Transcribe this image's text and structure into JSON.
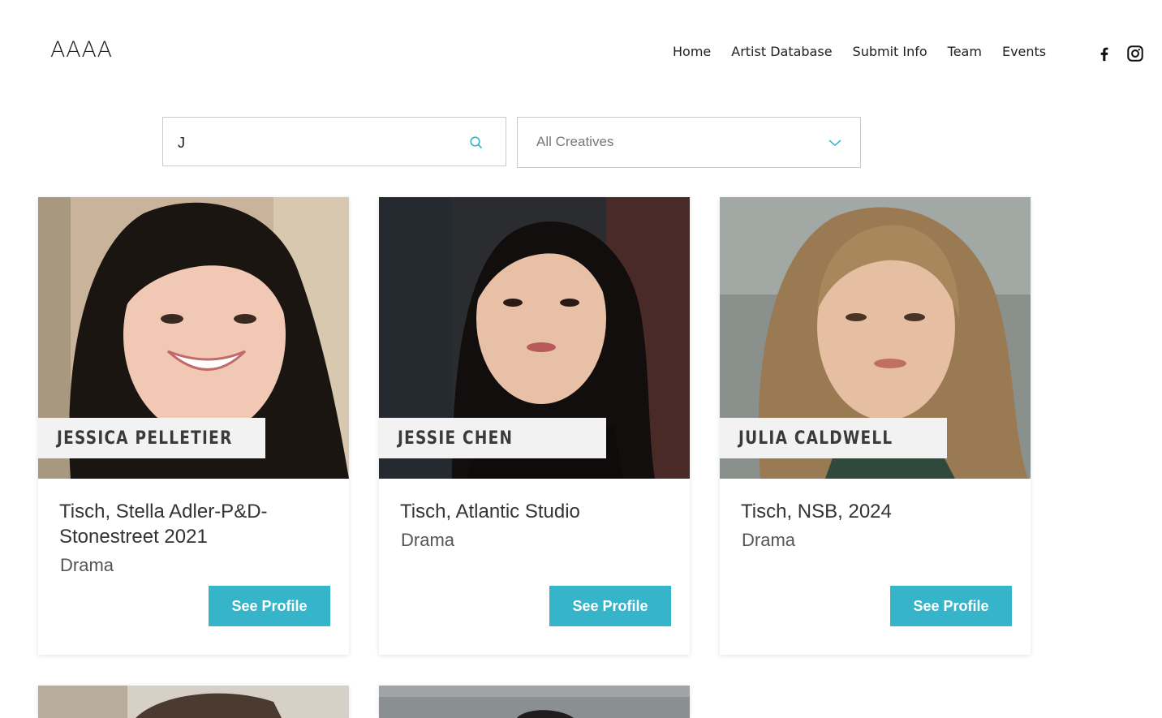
{
  "site": {
    "logo": "AAAA"
  },
  "nav": {
    "items": [
      "Home",
      "Artist Database",
      "Submit Info",
      "Team",
      "Events"
    ]
  },
  "social": [
    "facebook-icon",
    "instagram-icon"
  ],
  "search": {
    "value": "J",
    "icon": "search-icon"
  },
  "filter": {
    "selected": "All Creatives",
    "icon": "chevron-down-icon"
  },
  "colors": {
    "accent": "#36b4c9",
    "name_tag_bg": "#f2f2f2"
  },
  "artists": [
    {
      "name": "JESSICA PELLETIER",
      "school": "Tisch, Stella Adler-P&D-Stonestreet 2021",
      "department": "Drama",
      "button": "See Profile"
    },
    {
      "name": "JESSIE CHEN",
      "school": "Tisch, Atlantic Studio",
      "department": "Drama",
      "button": "See Profile"
    },
    {
      "name": "JULIA CALDWELL",
      "school": "Tisch, NSB, 2024",
      "department": "Drama",
      "button": "See Profile"
    }
  ]
}
